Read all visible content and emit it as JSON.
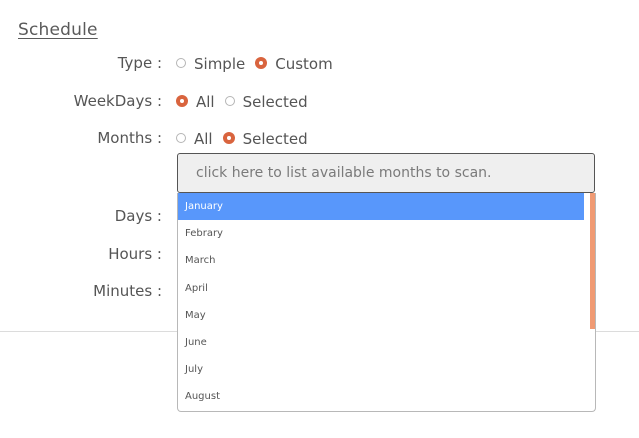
{
  "section": {
    "title": "Schedule"
  },
  "rows": {
    "type": {
      "label": "Type :",
      "options": [
        "Simple",
        "Custom"
      ],
      "selected": "Custom"
    },
    "weekdays": {
      "label": "WeekDays :",
      "options": [
        "All",
        "Selected"
      ],
      "selected": "All"
    },
    "months": {
      "label": "Months :",
      "options": [
        "All",
        "Selected"
      ],
      "selected": "Selected"
    },
    "days": {
      "label": "Days :"
    },
    "hours": {
      "label": "Hours :"
    },
    "minutes": {
      "label": "Minutes :"
    }
  },
  "months_select": {
    "placeholder": "click here to list available months to scan.",
    "options": [
      "January",
      "Febrary",
      "March",
      "April",
      "May",
      "June",
      "July",
      "August"
    ],
    "highlighted": "January"
  },
  "colors": {
    "accent": "#d9643e",
    "highlight": "#5897fb",
    "scrollbar": "#f09a73"
  }
}
